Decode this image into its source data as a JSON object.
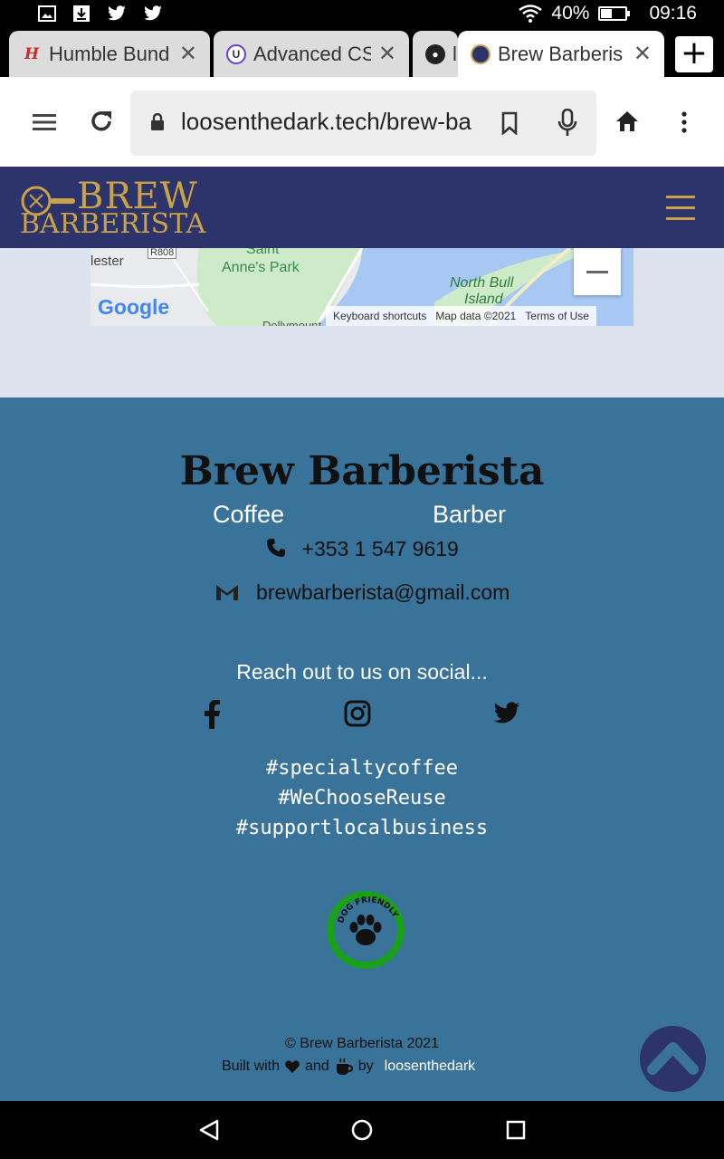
{
  "status_bar": {
    "battery": "40%",
    "time": "09:16",
    "battery_level": 0.4
  },
  "tabs": [
    {
      "title": "Humble Bund",
      "favicon": "humble-icon",
      "active": false
    },
    {
      "title": "Advanced CS",
      "favicon": "udemy-icon",
      "active": false
    },
    {
      "title": "l",
      "favicon": "github-icon",
      "active": false
    },
    {
      "title": "Brew Barberis",
      "favicon": "brew-icon",
      "active": true
    }
  ],
  "address_bar": {
    "url": "loosenthedark.tech/brew-ba"
  },
  "site": {
    "logo_line1": "BREW",
    "logo_line2": "BARBERISTA"
  },
  "map": {
    "labels": [
      "lester",
      "R808",
      "Saint",
      "Anne's Park",
      "North Bull",
      "Island",
      "Dollymount"
    ],
    "google": "Google",
    "keyboard": "Keyboard shortcuts",
    "mapdata": "Map data ©2021",
    "terms": "Terms of Use",
    "zoom_out": "−"
  },
  "footer": {
    "brand": "Brew Barberista",
    "sub_left": "Coffee",
    "sub_right": "Barber",
    "phone": "+353 1 547 9619",
    "email": "brewbarberista@gmail.com",
    "reach": "Reach out to us on social...",
    "tags": [
      "#specialtycoffee",
      "#WeChooseReuse",
      "#supportlocalbusiness"
    ],
    "badge_text": "DOG FRIENDLY",
    "copyright": "© Brew Barberista 2021",
    "built_with": "Built with",
    "and": "and",
    "by": "by",
    "author": "loosenthedark"
  },
  "colors": {
    "header": "#2d336b",
    "gold": "#c9a24a",
    "footer": "#3a7399",
    "map_bg": "#dde3ee"
  }
}
